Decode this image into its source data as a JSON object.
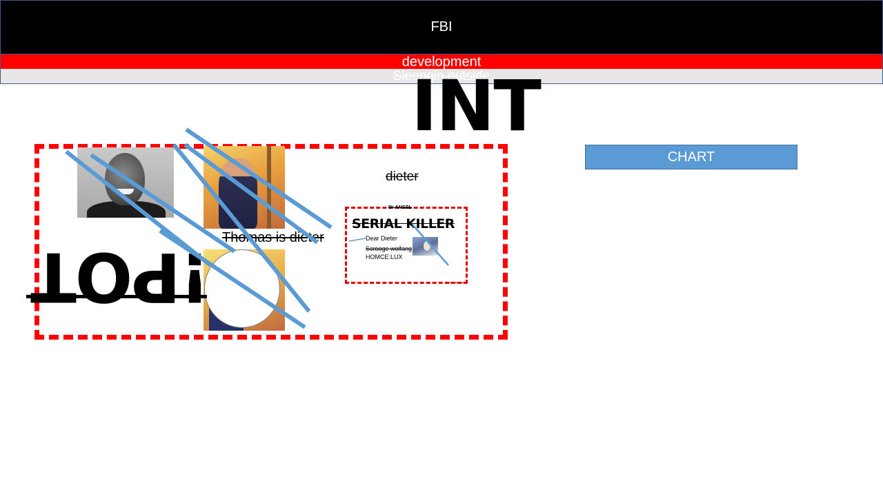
{
  "header": {
    "title": "FBI"
  },
  "banner": {
    "development": "development",
    "sleeping": "Sleepgin outside"
  },
  "headline": {
    "int": "INT"
  },
  "chart_button": {
    "label": "CHART"
  },
  "canvas": {
    "rotated_word": "!POT",
    "thomas_label": "Thomas is dieter",
    "dieter_label": "dieter"
  },
  "note_card": {
    "tiny_top": "Dr ANGEL",
    "title": "SERIAL KILLER",
    "dear": "Dear Dieter",
    "scrooge": "Scrooge wolfang",
    "homce": "HOMCE:LUX"
  },
  "colors": {
    "header_bg": "#000000",
    "dev_bar": "#ff0000",
    "sleep_bar": "#e8e6e6",
    "chart_button": "#5b9bd5",
    "frame_red": "#ff0000",
    "strike_blue": "#5b9bd5"
  }
}
